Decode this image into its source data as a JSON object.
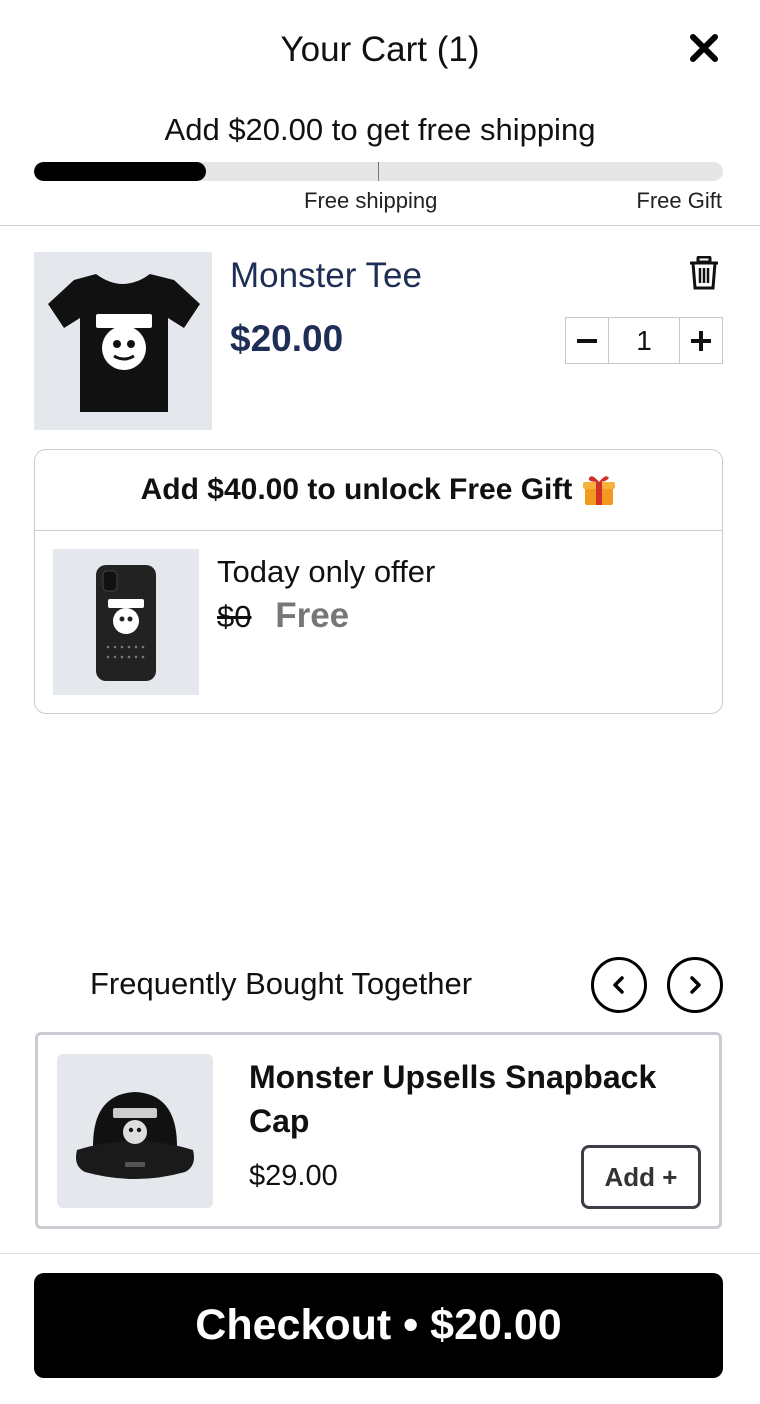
{
  "header": {
    "title": "Your Cart (1)",
    "close_icon": "close-icon"
  },
  "shipping": {
    "message": "Add $20.00 to get free shipping",
    "progress_fraction": 0.25,
    "milestones": [
      "Free shipping",
      "Free Gift"
    ]
  },
  "cart_item": {
    "name": "Monster Tee",
    "price": "$20.00",
    "quantity": "1",
    "image": "black monster t-shirt",
    "delete_icon": "trash-icon"
  },
  "gift_offer": {
    "headline": "Add $40.00 to unlock Free Gift",
    "icon": "gift-icon",
    "label": "Today only offer",
    "old_price": "$0",
    "new_price": "Free",
    "image": "black monster phone case"
  },
  "fbt": {
    "title": "Frequently Bought Together",
    "product": {
      "name": "Monster Upsells Snapback Cap",
      "price": "$29.00",
      "add_label": "Add +",
      "image": "black monster snapback cap"
    }
  },
  "checkout": {
    "label": "Checkout • $20.00"
  },
  "colors": {
    "accent": "#000000",
    "product_text": "#1f2e56",
    "free_text": "#777777"
  }
}
